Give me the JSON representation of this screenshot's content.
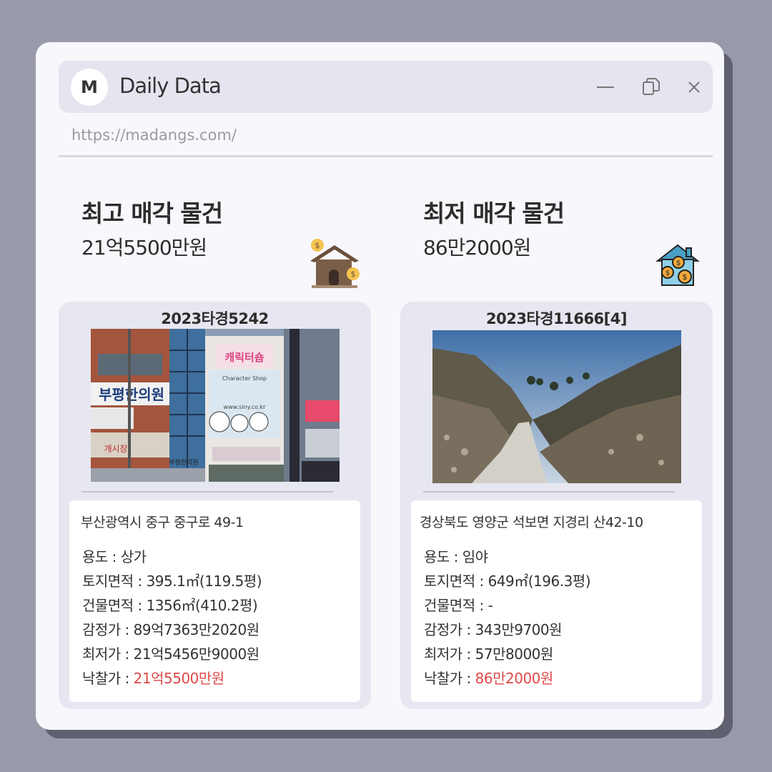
{
  "window": {
    "logo_letter": "M",
    "title": "Daily Data",
    "url": "https://madangs.com/"
  },
  "highest": {
    "heading": "최고 매각 물건",
    "price": "21억5500만원",
    "case_no": "2023타경5242",
    "address": "부산광역시 중구 중구로 49-1",
    "rows": {
      "usage_label": "용도 : ",
      "usage_value": "상가",
      "land_label": "토지면적 : ",
      "land_value": "395.1㎡(119.5평)",
      "building_label": "건물면적 : ",
      "building_value": "1356㎡(410.2평)",
      "appraisal_label": "감정가 : ",
      "appraisal_value": "89억7363만2020원",
      "minimum_label": "최저가 : ",
      "minimum_value": "21억5456만9000원",
      "winning_label": "낙찰가 : ",
      "winning_value": "21억5500만원"
    },
    "photo_signs": {
      "main_sign": "부평한의원",
      "shop_sign": "캐릭터숍",
      "shop_sub": "Character Shop",
      "shop_url": "www.siny.co.kr",
      "lower_sign": "부평한의원",
      "side_sign": "개시장"
    }
  },
  "lowest": {
    "heading": "최저 매각 물건",
    "price": "86만2000원",
    "case_no": "2023타경11666[4]",
    "address": "경상북도 영양군 석보면 지경리 산42-10",
    "rows": {
      "usage_label": "용도 : ",
      "usage_value": "임야",
      "land_label": "토지면적 : ",
      "land_value": "649㎡(196.3평)",
      "building_label": "건물면적 : ",
      "building_value": "-",
      "appraisal_label": "감정가 : ",
      "appraisal_value": "343만9700원",
      "minimum_label": "최저가 : ",
      "minimum_value": "57만8000원",
      "winning_label": "낙찰가 : ",
      "winning_value": "86만2000원"
    }
  },
  "icons": {
    "minimize": "minimize-icon",
    "restore": "restore-icon",
    "close": "close-icon",
    "house_dollar": "house-dollar-icon",
    "house_coins": "house-coins-icon"
  },
  "colors": {
    "background": "#989aac",
    "window": "#f7f7fc",
    "card": "#e6e7f0",
    "highlight_price": "#e04848"
  }
}
